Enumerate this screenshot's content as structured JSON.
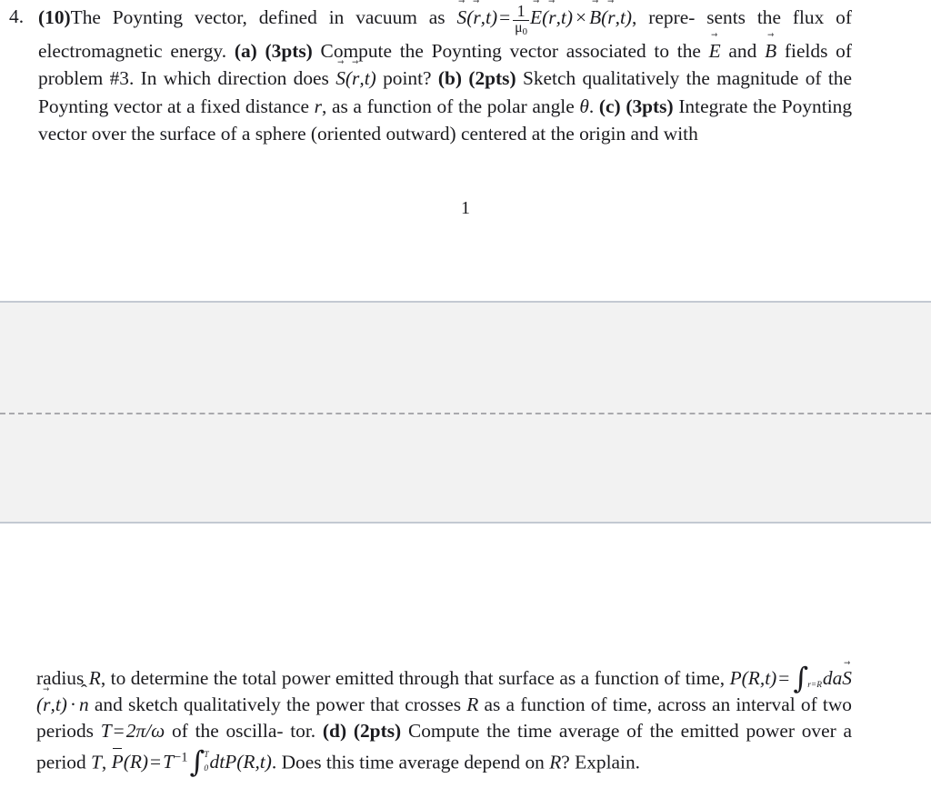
{
  "document": {
    "background_color": "#ffffff",
    "text_color": "#1b1b1f",
    "page_number": "1"
  },
  "problem": {
    "number": "4.",
    "points": "(10)",
    "line1_a": "The Poynting vector, defined in vacuum as ",
    "math_poynting": {
      "S": "S",
      "r": "r",
      "t": "t",
      "equals": "=",
      "frac_num": "1",
      "frac_den": "μ",
      "frac_den_sub": "0",
      "E": "E",
      "times": "×",
      "B": "B"
    },
    "line1_b": ", repre-",
    "line2": "sents the flux of electromagnetic energy. ",
    "part_a_label": "(a)",
    "part_a_points": "(3pts)",
    "part_a_text1": "Compute the Poynting vector associated to the ",
    "part_a_E": "E",
    "part_a_and": " and ",
    "part_a_B": "B",
    "part_a_text2": " fields of problem #3. In which direction does ",
    "part_a_text3": " point? ",
    "part_b_label": "(b)",
    "part_b_points": "(2pts)",
    "part_b_text1": "Sketch qualitatively the magnitude of the Poynting vector at a fixed distance ",
    "part_b_r": "r",
    "part_b_text2": ", as a function of the polar angle ",
    "part_b_theta": "θ",
    "part_b_text3": ". ",
    "part_c_label": "(c)",
    "part_c_points": "(3pts)",
    "part_c_text1": "Integrate the Poynting vector over the surface of a sphere (oriented outward) centered at the origin and with"
  },
  "continuation": {
    "text1": "radius ",
    "R": "R",
    "text2": ", to determine the total power emitted through that surface as a function of time, ",
    "math_power": {
      "P": "P",
      "R": "R",
      "t": "t",
      "equals": "=",
      "int_limit": "r=R",
      "da": "da",
      "S": "S",
      "cdot": "·",
      "nhat": "n"
    },
    "text3": " and sketch qualitatively the power that crosses ",
    "R2": "R",
    "text4": " as a function of time, across an interval of two periods ",
    "T": "T",
    "eq": "=",
    "two_pi_over_omega_num": "2π",
    "two_pi_over_omega_den": "ω",
    "text5": " of the oscilla-",
    "text6": "tor. ",
    "part_d_label": "(d)",
    "part_d_points": "(2pts)",
    "part_d_text1": "Compute the time average of the emitted power over a period ",
    "part_d_T": "T",
    "part_d_comma": ",",
    "math_avg": {
      "Pbar": "P",
      "R": "R",
      "equals": "=",
      "T": "T",
      "exp": "−1",
      "int_lo": "0",
      "int_hi": "T",
      "dt": "dt",
      "P": "P",
      "t": "t"
    },
    "text7": ". Does this time average depend on ",
    "R3": "R",
    "text8": "? Explain."
  },
  "separator": {
    "band_color": "#f2f2f2",
    "border_color": "#c3c9d2",
    "dashed_color": "#a9a9ad"
  }
}
